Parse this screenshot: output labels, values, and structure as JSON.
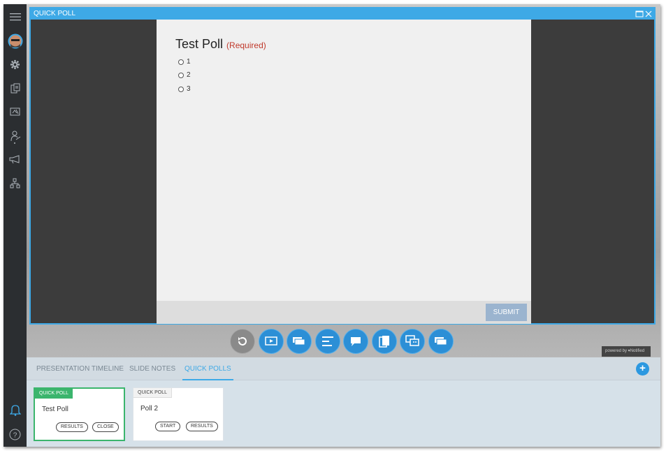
{
  "window": {
    "title": "QUICK POLL"
  },
  "poll": {
    "title": "Test Poll",
    "required": "(Required)",
    "options": [
      "1",
      "2",
      "3"
    ],
    "submit_label": "SUBMIT"
  },
  "toolbar": {
    "buttons": [
      "refresh-icon",
      "slideshow-icon",
      "stack-icon",
      "align-left-icon",
      "chat-icon",
      "pages-icon",
      "qa-icon",
      "screens-icon"
    ]
  },
  "powered_by": "powered by ▾Notified",
  "tabs": [
    {
      "label": "PRESENTATION TIMELINE",
      "active": false
    },
    {
      "label": "SLIDE NOTES",
      "active": false
    },
    {
      "label": "QUICK POLLS",
      "active": true
    }
  ],
  "add_label": "+",
  "cards": [
    {
      "badge": "QUICK POLL",
      "title": "Test Poll",
      "buttons": [
        "RESULTS",
        "CLOSE"
      ],
      "active": true
    },
    {
      "badge": "QUICK POLL",
      "title": "Poll 2",
      "buttons": [
        "START",
        "RESULTS"
      ],
      "active": false
    }
  ],
  "colors": {
    "accent": "#3ea9e6",
    "active_green": "#3bb56d",
    "required_red": "#c0392b",
    "sidebar": "#2b2e31"
  }
}
